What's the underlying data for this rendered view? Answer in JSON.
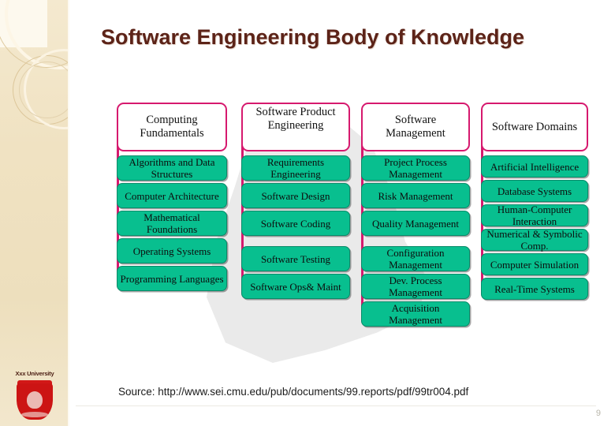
{
  "slide": {
    "title": "Software Engineering Body of Knowledge",
    "page_number": "9",
    "source": "Source: http://www.sei.cmu.edu/pub/documents/99.reports/pdf/99tr004.pdf"
  },
  "brand": {
    "name": "Xxx University",
    "crest_icon": "shield-crest-icon"
  },
  "colors": {
    "title": "#5c2318",
    "header_border": "#d6196e",
    "item_fill": "#08bf8f",
    "item_border": "#0a8a69",
    "sidebar": "#f0e2c2",
    "crest": "#cc1414"
  },
  "diagram": {
    "columns": [
      {
        "header": "Computing Fundamentals",
        "header_lines": 2,
        "items": [
          {
            "label": "Algorithms and Data Structures",
            "gap": false
          },
          {
            "label": "Computer Architecture",
            "gap": false
          },
          {
            "label": "Mathematical Foundations",
            "gap": false
          },
          {
            "label": "Operating Systems",
            "gap": false
          },
          {
            "label": "Programming Languages",
            "gap": false
          }
        ]
      },
      {
        "header": "Software Product Engineering",
        "header_lines": 3,
        "items": [
          {
            "label": "Requirements Engineering",
            "gap": false
          },
          {
            "label": "Software Design",
            "gap": false
          },
          {
            "label": "Software Coding",
            "gap": false
          },
          {
            "label": "Software Testing",
            "gap": true
          },
          {
            "label": "Software Ops& Maint",
            "gap": false
          }
        ]
      },
      {
        "header": "Software Management",
        "header_lines": 2,
        "items": [
          {
            "label": "Project Process Management",
            "gap": false
          },
          {
            "label": "Risk Management",
            "gap": false
          },
          {
            "label": "Quality Management",
            "gap": false
          },
          {
            "label": "Configuration Management",
            "gap": true
          },
          {
            "label": "Dev. Process Management",
            "gap": false
          },
          {
            "label": "Acquisition Management",
            "gap": false
          }
        ]
      },
      {
        "header": "Software Domains",
        "header_lines": 2,
        "items": [
          {
            "label": "Artificial Intelligence",
            "gap": false
          },
          {
            "label": "Database Systems",
            "gap": false
          },
          {
            "label": "Human-Computer Interaction",
            "gap": false
          },
          {
            "label": "Numerical & Symbolic Comp.",
            "gap": false
          },
          {
            "label": "Computer Simulation",
            "gap": false
          },
          {
            "label": "Real-Time Systems",
            "gap": false
          }
        ]
      }
    ]
  }
}
